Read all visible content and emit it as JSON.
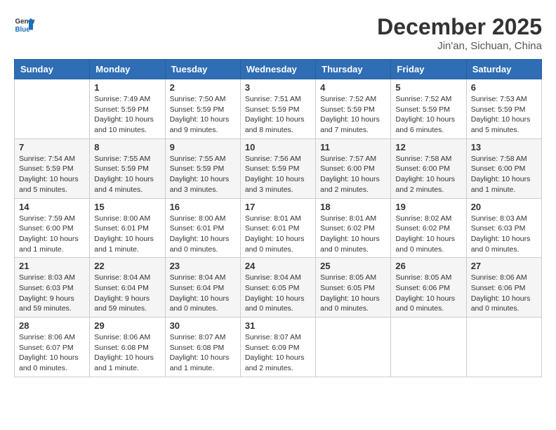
{
  "header": {
    "logo_line1": "General",
    "logo_line2": "Blue",
    "month": "December 2025",
    "location": "Jin'an, Sichuan, China"
  },
  "days_of_week": [
    "Sunday",
    "Monday",
    "Tuesday",
    "Wednesday",
    "Thursday",
    "Friday",
    "Saturday"
  ],
  "weeks": [
    [
      {
        "day": "",
        "info": ""
      },
      {
        "day": "1",
        "info": "Sunrise: 7:49 AM\nSunset: 5:59 PM\nDaylight: 10 hours and 10 minutes."
      },
      {
        "day": "2",
        "info": "Sunrise: 7:50 AM\nSunset: 5:59 PM\nDaylight: 10 hours and 9 minutes."
      },
      {
        "day": "3",
        "info": "Sunrise: 7:51 AM\nSunset: 5:59 PM\nDaylight: 10 hours and 8 minutes."
      },
      {
        "day": "4",
        "info": "Sunrise: 7:52 AM\nSunset: 5:59 PM\nDaylight: 10 hours and 7 minutes."
      },
      {
        "day": "5",
        "info": "Sunrise: 7:52 AM\nSunset: 5:59 PM\nDaylight: 10 hours and 6 minutes."
      },
      {
        "day": "6",
        "info": "Sunrise: 7:53 AM\nSunset: 5:59 PM\nDaylight: 10 hours and 5 minutes."
      }
    ],
    [
      {
        "day": "7",
        "info": "Sunrise: 7:54 AM\nSunset: 5:59 PM\nDaylight: 10 hours and 5 minutes."
      },
      {
        "day": "8",
        "info": "Sunrise: 7:55 AM\nSunset: 5:59 PM\nDaylight: 10 hours and 4 minutes."
      },
      {
        "day": "9",
        "info": "Sunrise: 7:55 AM\nSunset: 5:59 PM\nDaylight: 10 hours and 3 minutes."
      },
      {
        "day": "10",
        "info": "Sunrise: 7:56 AM\nSunset: 5:59 PM\nDaylight: 10 hours and 3 minutes."
      },
      {
        "day": "11",
        "info": "Sunrise: 7:57 AM\nSunset: 6:00 PM\nDaylight: 10 hours and 2 minutes."
      },
      {
        "day": "12",
        "info": "Sunrise: 7:58 AM\nSunset: 6:00 PM\nDaylight: 10 hours and 2 minutes."
      },
      {
        "day": "13",
        "info": "Sunrise: 7:58 AM\nSunset: 6:00 PM\nDaylight: 10 hours and 1 minute."
      }
    ],
    [
      {
        "day": "14",
        "info": "Sunrise: 7:59 AM\nSunset: 6:00 PM\nDaylight: 10 hours and 1 minute."
      },
      {
        "day": "15",
        "info": "Sunrise: 8:00 AM\nSunset: 6:01 PM\nDaylight: 10 hours and 1 minute."
      },
      {
        "day": "16",
        "info": "Sunrise: 8:00 AM\nSunset: 6:01 PM\nDaylight: 10 hours and 0 minutes."
      },
      {
        "day": "17",
        "info": "Sunrise: 8:01 AM\nSunset: 6:01 PM\nDaylight: 10 hours and 0 minutes."
      },
      {
        "day": "18",
        "info": "Sunrise: 8:01 AM\nSunset: 6:02 PM\nDaylight: 10 hours and 0 minutes."
      },
      {
        "day": "19",
        "info": "Sunrise: 8:02 AM\nSunset: 6:02 PM\nDaylight: 10 hours and 0 minutes."
      },
      {
        "day": "20",
        "info": "Sunrise: 8:03 AM\nSunset: 6:03 PM\nDaylight: 10 hours and 0 minutes."
      }
    ],
    [
      {
        "day": "21",
        "info": "Sunrise: 8:03 AM\nSunset: 6:03 PM\nDaylight: 9 hours and 59 minutes."
      },
      {
        "day": "22",
        "info": "Sunrise: 8:04 AM\nSunset: 6:04 PM\nDaylight: 9 hours and 59 minutes."
      },
      {
        "day": "23",
        "info": "Sunrise: 8:04 AM\nSunset: 6:04 PM\nDaylight: 10 hours and 0 minutes."
      },
      {
        "day": "24",
        "info": "Sunrise: 8:04 AM\nSunset: 6:05 PM\nDaylight: 10 hours and 0 minutes."
      },
      {
        "day": "25",
        "info": "Sunrise: 8:05 AM\nSunset: 6:05 PM\nDaylight: 10 hours and 0 minutes."
      },
      {
        "day": "26",
        "info": "Sunrise: 8:05 AM\nSunset: 6:06 PM\nDaylight: 10 hours and 0 minutes."
      },
      {
        "day": "27",
        "info": "Sunrise: 8:06 AM\nSunset: 6:06 PM\nDaylight: 10 hours and 0 minutes."
      }
    ],
    [
      {
        "day": "28",
        "info": "Sunrise: 8:06 AM\nSunset: 6:07 PM\nDaylight: 10 hours and 0 minutes."
      },
      {
        "day": "29",
        "info": "Sunrise: 8:06 AM\nSunset: 6:08 PM\nDaylight: 10 hours and 1 minute."
      },
      {
        "day": "30",
        "info": "Sunrise: 8:07 AM\nSunset: 6:08 PM\nDaylight: 10 hours and 1 minute."
      },
      {
        "day": "31",
        "info": "Sunrise: 8:07 AM\nSunset: 6:09 PM\nDaylight: 10 hours and 2 minutes."
      },
      {
        "day": "",
        "info": ""
      },
      {
        "day": "",
        "info": ""
      },
      {
        "day": "",
        "info": ""
      }
    ]
  ]
}
